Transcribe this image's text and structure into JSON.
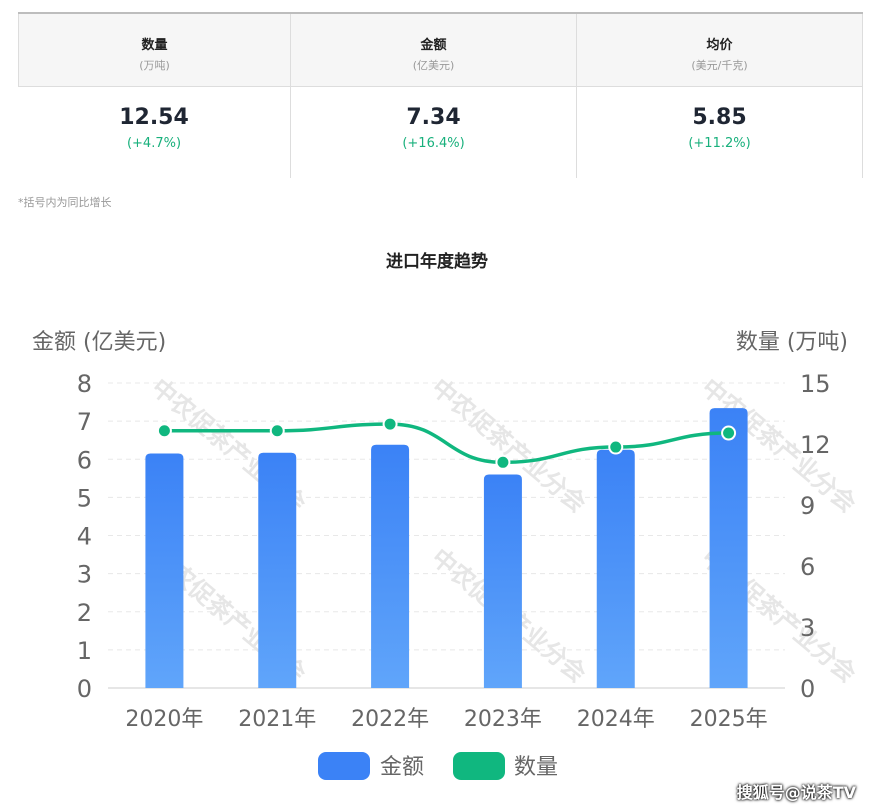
{
  "table": {
    "headers": [
      {
        "title": "数量",
        "unit": "(万吨)"
      },
      {
        "title": "金额",
        "unit": "(亿美元)"
      },
      {
        "title": "均价",
        "unit": "(美元/千克)"
      }
    ],
    "values": [
      {
        "value": "12.54",
        "growth": "(+4.7%)"
      },
      {
        "value": "7.34",
        "growth": "(+16.4%)"
      },
      {
        "value": "5.85",
        "growth": "(+11.2%)"
      }
    ],
    "note": "*括号内为同比增长"
  },
  "watermark": "搜狐号@说茶TV",
  "bg_watermark": "中农促茶产业分会",
  "chart_data": {
    "type": "bar+line",
    "title": "进口年度趋势",
    "categories": [
      "2020年",
      "2021年",
      "2022年",
      "2023年",
      "2024年",
      "2025年"
    ],
    "series": [
      {
        "name": "金额",
        "type": "bar",
        "axis": "left",
        "values": [
          6.15,
          6.17,
          6.38,
          5.6,
          6.25,
          7.34
        ],
        "color": "#3b82f6"
      },
      {
        "name": "数量",
        "type": "line",
        "axis": "right",
        "values": [
          12.65,
          12.65,
          12.98,
          11.1,
          11.85,
          12.54
        ],
        "color": "#10b77f"
      }
    ],
    "ylabel_left": "金额 (亿美元)",
    "ylim_left": [
      0,
      8
    ],
    "yticks_left": [
      "0",
      "1",
      "2",
      "3",
      "4",
      "5",
      "6",
      "7",
      "8"
    ],
    "ylabel_right": "数量 (万吨)",
    "ylim_right": [
      0,
      15
    ],
    "yticks_right": [
      "0",
      "3",
      "6",
      "9",
      "12",
      "15"
    ],
    "legend": "bottom",
    "grid": true
  }
}
